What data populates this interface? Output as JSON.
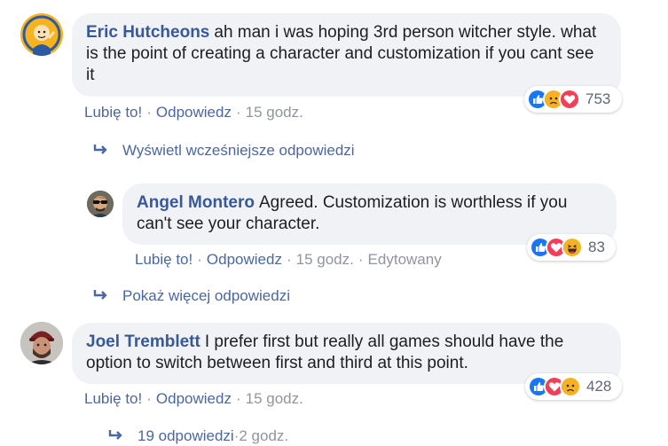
{
  "comments": [
    {
      "author": "Eric Hutcheons",
      "text": "ah man i was hoping 3rd person witcher style. what is the point of creating a character and customization if you cant see it",
      "actions": {
        "like": "Lubię to!",
        "reply": "Odpowiedz",
        "time": "15 godz."
      },
      "reactions": {
        "icons": [
          "like-icon",
          "sad-icon",
          "love-icon"
        ],
        "count": "753"
      }
    },
    {
      "author": "Angel Montero",
      "text": "Agreed. Customization is worthless if you can't see your character.",
      "actions": {
        "like": "Lubię to!",
        "reply": "Odpowiedz",
        "time": "15 godz.",
        "edited": "Edytowany"
      },
      "reactions": {
        "icons": [
          "like-icon",
          "love-icon",
          "haha-icon"
        ],
        "count": "83"
      }
    },
    {
      "author": "Joel Tremblett",
      "text": "I prefer first but really all games should have the option to switch between first and third at this point.",
      "actions": {
        "like": "Lubię to!",
        "reply": "Odpowiedz",
        "time": "15 godz."
      },
      "reactions": {
        "icons": [
          "like-icon",
          "love-icon",
          "sad-icon"
        ],
        "count": "428"
      }
    }
  ],
  "links": {
    "earlier_replies": "Wyświetl wcześniejsze odpowiedzi",
    "more_replies": "Pokaż więcej odpowiedzi",
    "replies_count": "19 odpowiedzi",
    "replies_time": "2 godz."
  },
  "colors": {
    "bubble": "#f0f2f5",
    "author": "#385898",
    "link": "#4b67a1",
    "muted": "#90949c",
    "like": "#1877f2",
    "love": "#f33e58",
    "emoji": "#f7b125"
  }
}
